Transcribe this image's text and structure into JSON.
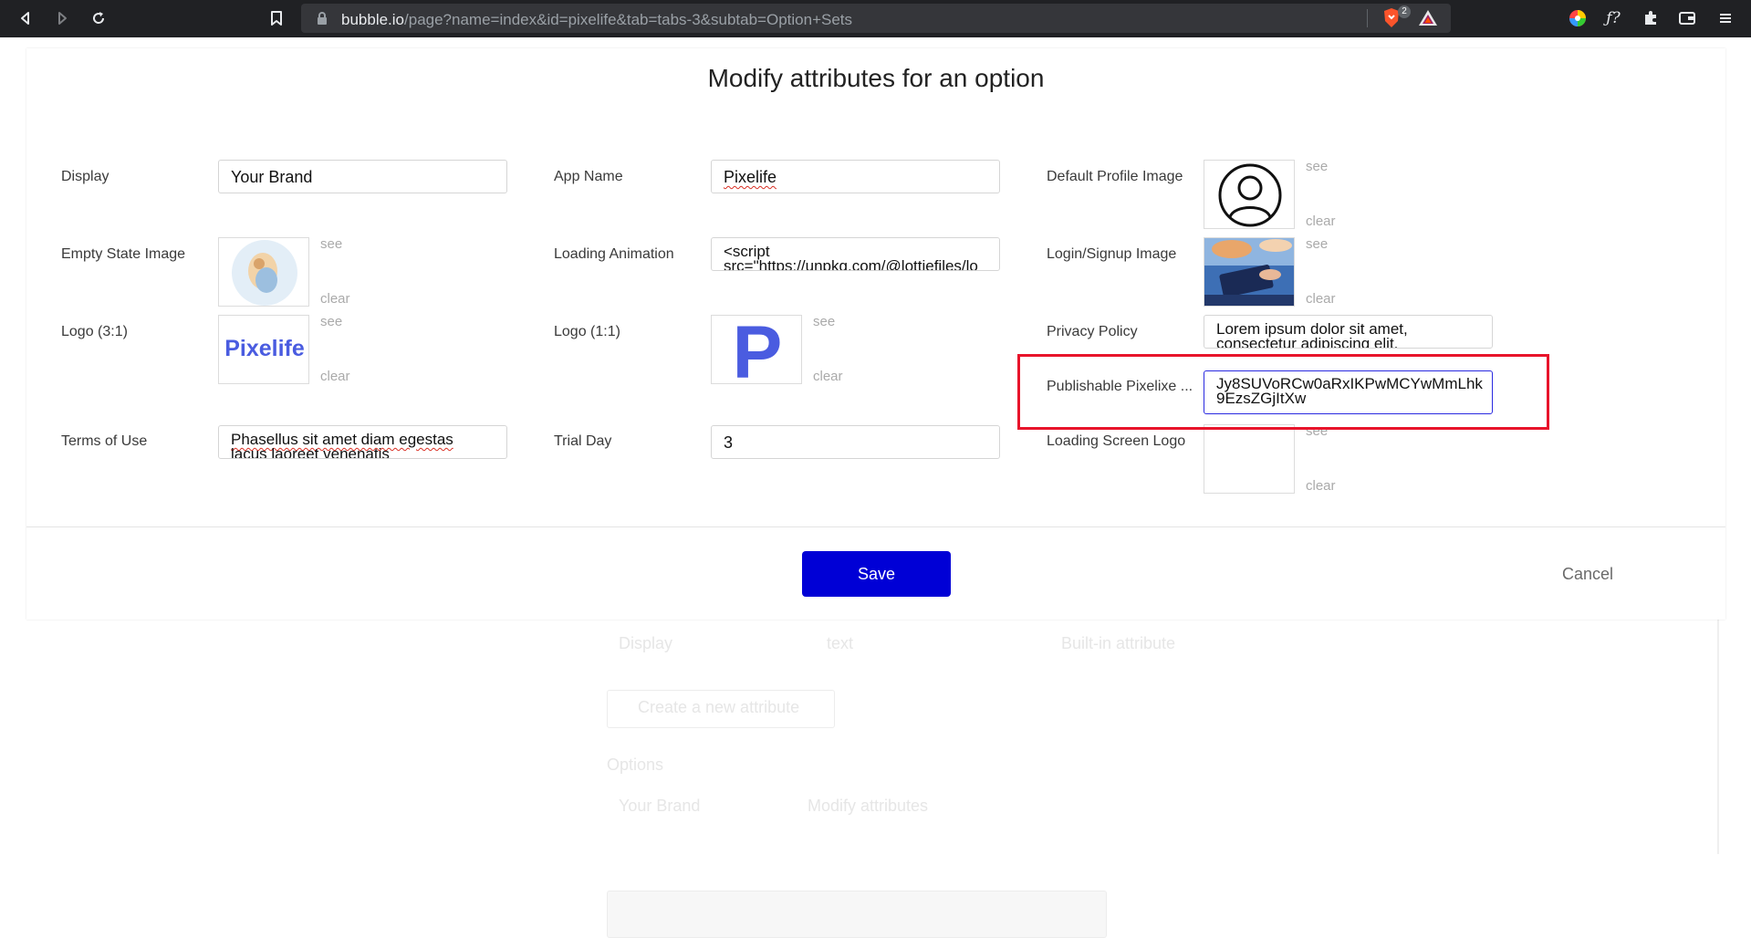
{
  "browser": {
    "url_host": "bubble.io",
    "url_path": "/page?name=index&id=pixelife&tab=tabs-3&subtab=Option+Sets",
    "brave_badge": "2"
  },
  "background": {
    "display_label": "Display",
    "text_label": "text",
    "builtin_label": "Built-in attribute",
    "create_attr": "Create a new attribute",
    "options_label": "Options",
    "your_brand": "Your Brand",
    "modify_attributes": "Modify attributes"
  },
  "modal": {
    "title": "Modify attributes for an option",
    "save_label": "Save",
    "cancel_label": "Cancel",
    "see_label": "see",
    "clear_label": "clear",
    "fields": {
      "display": {
        "label": "Display",
        "value": "Your Brand"
      },
      "app_name": {
        "label": "App Name",
        "value": "Pixelife"
      },
      "default_profile_image": {
        "label": "Default Profile Image"
      },
      "empty_state_image": {
        "label": "Empty State Image"
      },
      "loading_animation": {
        "label": "Loading Animation",
        "line1": "<script",
        "line2": "src=\"https://unpkg.com/@lottiefiles/lo"
      },
      "login_signup_image": {
        "label": "Login/Signup Image"
      },
      "logo_3_1": {
        "label": "Logo (3:1)",
        "logo_text": "Pixelife"
      },
      "logo_1_1": {
        "label": "Logo (1:1)",
        "logo_letter": "P"
      },
      "privacy_policy": {
        "label": "Privacy Policy",
        "line1": "Lorem ipsum dolor sit amet,",
        "line2": "consectetur adipiscing elit."
      },
      "publishable_key": {
        "label": "Publishable Pixelixe ...",
        "line1": "Jy8SUVoRCw0aRxIKPwMCYwMmLhk",
        "line2": "9EzsZGjItXw"
      },
      "terms_of_use": {
        "label": "Terms of Use",
        "line1": "Phasellus sit amet diam egestas",
        "line2": "lacus laoreet venenatis"
      },
      "trial_day": {
        "label": "Trial Day",
        "value": "3"
      },
      "loading_screen_logo": {
        "label": "Loading Screen Logo"
      }
    }
  },
  "colors": {
    "save_button": "#0000d6",
    "highlight": "#e8142b",
    "logo_blue": "#4a5ce0"
  }
}
